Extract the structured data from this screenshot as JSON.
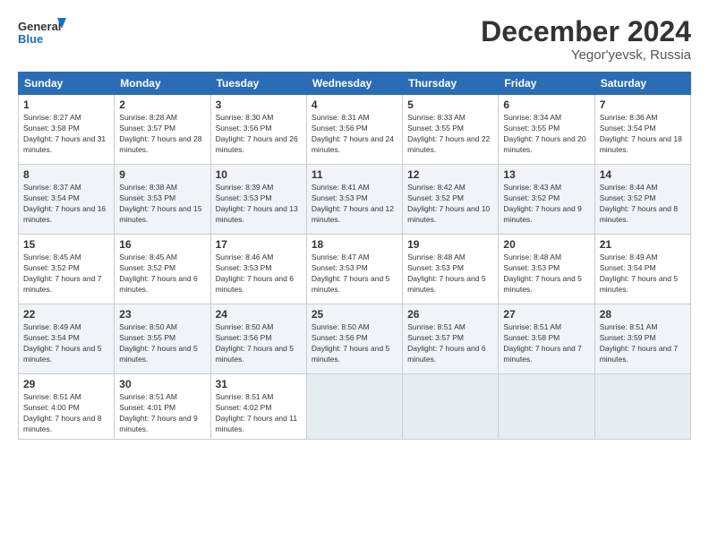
{
  "logo": {
    "line1": "General",
    "line2": "Blue"
  },
  "title": "December 2024",
  "location": "Yegor'yevsk, Russia",
  "days_header": [
    "Sunday",
    "Monday",
    "Tuesday",
    "Wednesday",
    "Thursday",
    "Friday",
    "Saturday"
  ],
  "weeks": [
    [
      {
        "day": "1",
        "sunrise": "8:27 AM",
        "sunset": "3:58 PM",
        "daylight": "7 hours and 31 minutes."
      },
      {
        "day": "2",
        "sunrise": "8:28 AM",
        "sunset": "3:57 PM",
        "daylight": "7 hours and 28 minutes."
      },
      {
        "day": "3",
        "sunrise": "8:30 AM",
        "sunset": "3:56 PM",
        "daylight": "7 hours and 26 minutes."
      },
      {
        "day": "4",
        "sunrise": "8:31 AM",
        "sunset": "3:56 PM",
        "daylight": "7 hours and 24 minutes."
      },
      {
        "day": "5",
        "sunrise": "8:33 AM",
        "sunset": "3:55 PM",
        "daylight": "7 hours and 22 minutes."
      },
      {
        "day": "6",
        "sunrise": "8:34 AM",
        "sunset": "3:55 PM",
        "daylight": "7 hours and 20 minutes."
      },
      {
        "day": "7",
        "sunrise": "8:36 AM",
        "sunset": "3:54 PM",
        "daylight": "7 hours and 18 minutes."
      }
    ],
    [
      {
        "day": "8",
        "sunrise": "8:37 AM",
        "sunset": "3:54 PM",
        "daylight": "7 hours and 16 minutes."
      },
      {
        "day": "9",
        "sunrise": "8:38 AM",
        "sunset": "3:53 PM",
        "daylight": "7 hours and 15 minutes."
      },
      {
        "day": "10",
        "sunrise": "8:39 AM",
        "sunset": "3:53 PM",
        "daylight": "7 hours and 13 minutes."
      },
      {
        "day": "11",
        "sunrise": "8:41 AM",
        "sunset": "3:53 PM",
        "daylight": "7 hours and 12 minutes."
      },
      {
        "day": "12",
        "sunrise": "8:42 AM",
        "sunset": "3:52 PM",
        "daylight": "7 hours and 10 minutes."
      },
      {
        "day": "13",
        "sunrise": "8:43 AM",
        "sunset": "3:52 PM",
        "daylight": "7 hours and 9 minutes."
      },
      {
        "day": "14",
        "sunrise": "8:44 AM",
        "sunset": "3:52 PM",
        "daylight": "7 hours and 8 minutes."
      }
    ],
    [
      {
        "day": "15",
        "sunrise": "8:45 AM",
        "sunset": "3:52 PM",
        "daylight": "7 hours and 7 minutes."
      },
      {
        "day": "16",
        "sunrise": "8:45 AM",
        "sunset": "3:52 PM",
        "daylight": "7 hours and 6 minutes."
      },
      {
        "day": "17",
        "sunrise": "8:46 AM",
        "sunset": "3:53 PM",
        "daylight": "7 hours and 6 minutes."
      },
      {
        "day": "18",
        "sunrise": "8:47 AM",
        "sunset": "3:53 PM",
        "daylight": "7 hours and 5 minutes."
      },
      {
        "day": "19",
        "sunrise": "8:48 AM",
        "sunset": "3:53 PM",
        "daylight": "7 hours and 5 minutes."
      },
      {
        "day": "20",
        "sunrise": "8:48 AM",
        "sunset": "3:53 PM",
        "daylight": "7 hours and 5 minutes."
      },
      {
        "day": "21",
        "sunrise": "8:49 AM",
        "sunset": "3:54 PM",
        "daylight": "7 hours and 5 minutes."
      }
    ],
    [
      {
        "day": "22",
        "sunrise": "8:49 AM",
        "sunset": "3:54 PM",
        "daylight": "7 hours and 5 minutes."
      },
      {
        "day": "23",
        "sunrise": "8:50 AM",
        "sunset": "3:55 PM",
        "daylight": "7 hours and 5 minutes."
      },
      {
        "day": "24",
        "sunrise": "8:50 AM",
        "sunset": "3:56 PM",
        "daylight": "7 hours and 5 minutes."
      },
      {
        "day": "25",
        "sunrise": "8:50 AM",
        "sunset": "3:56 PM",
        "daylight": "7 hours and 5 minutes."
      },
      {
        "day": "26",
        "sunrise": "8:51 AM",
        "sunset": "3:57 PM",
        "daylight": "7 hours and 6 minutes."
      },
      {
        "day": "27",
        "sunrise": "8:51 AM",
        "sunset": "3:58 PM",
        "daylight": "7 hours and 7 minutes."
      },
      {
        "day": "28",
        "sunrise": "8:51 AM",
        "sunset": "3:59 PM",
        "daylight": "7 hours and 7 minutes."
      }
    ],
    [
      {
        "day": "29",
        "sunrise": "8:51 AM",
        "sunset": "4:00 PM",
        "daylight": "7 hours and 8 minutes."
      },
      {
        "day": "30",
        "sunrise": "8:51 AM",
        "sunset": "4:01 PM",
        "daylight": "7 hours and 9 minutes."
      },
      {
        "day": "31",
        "sunrise": "8:51 AM",
        "sunset": "4:02 PM",
        "daylight": "7 hours and 11 minutes."
      },
      null,
      null,
      null,
      null
    ]
  ]
}
